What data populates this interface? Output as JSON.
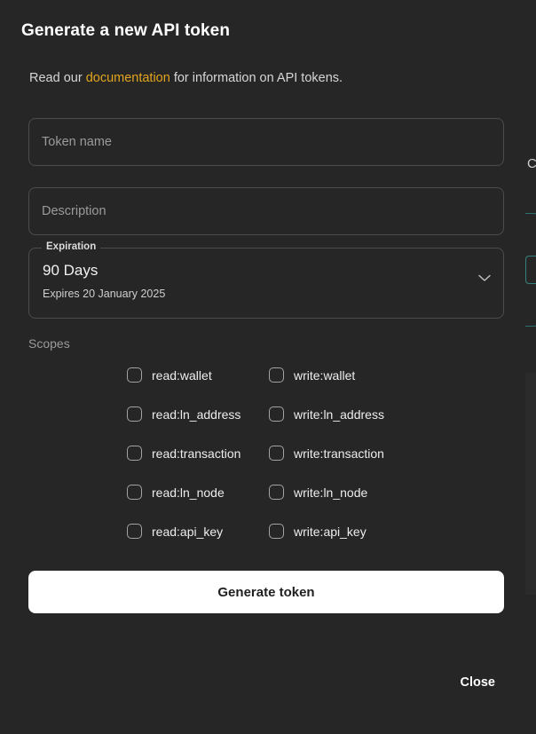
{
  "dialog": {
    "title": "Generate a new API token",
    "subtitle_prefix": "Read our ",
    "subtitle_link": "documentation",
    "subtitle_suffix": " for information on API tokens.",
    "link_color": "#e3a51d"
  },
  "fields": {
    "token_name": {
      "value": "",
      "placeholder": "Token name"
    },
    "description": {
      "value": "",
      "placeholder": "Description"
    }
  },
  "expiration": {
    "legend": "Expiration",
    "value": "90 Days",
    "sub": "Expires 20 January 2025",
    "icon": "chevron-down-icon"
  },
  "scopes": {
    "label": "Scopes",
    "rows": [
      {
        "read": "read:wallet",
        "write": "write:wallet"
      },
      {
        "read": "read:ln_address",
        "write": "write:ln_address"
      },
      {
        "read": "read:transaction",
        "write": "write:transaction"
      },
      {
        "read": "read:ln_node",
        "write": "write:ln_node"
      },
      {
        "read": "read:api_key",
        "write": "write:api_key"
      }
    ]
  },
  "actions": {
    "generate_label": "Generate token",
    "close_label": "Close"
  },
  "background": {
    "partial_letter": "C"
  }
}
